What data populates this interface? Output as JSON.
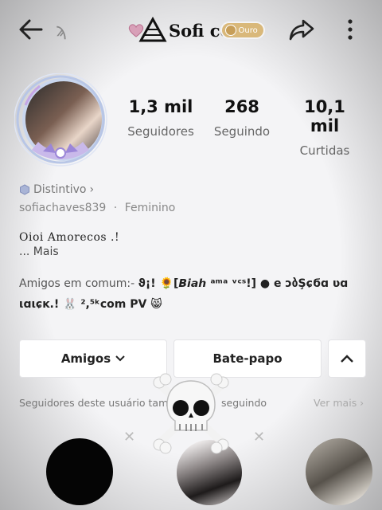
{
  "header": {
    "small_glyph": "ϡ",
    "brand_name": "Sofi col",
    "badge_label": "Ouro"
  },
  "profile": {
    "stats": [
      {
        "value": "1,3 mil",
        "label": "Seguidores"
      },
      {
        "value": "268",
        "label": "Seguindo"
      },
      {
        "value": "10,1 mil",
        "label": "Curtidas"
      }
    ],
    "distintivo_label": "Distintivo",
    "distintivo_arrow": "›",
    "username": "sofiachaves839",
    "separator": "·",
    "gender": "Feminino",
    "bio_line1": "Oioi Amorecos .!",
    "bio_more": "...  Mais",
    "mutual_prefix": "Amigos em comum:- ",
    "mutual_names_1": "ϑ¡! 🌻[𝘽𝙞𝙖𝙝 ᵃᵐᵃ ᵛᶜˢ!] ● e ɔბŞɕϭɑ ʋɑ",
    "mutual_names_2": "ιɑιɕĸ.! 🐰 ²,⁵ᵏcom PV 😸"
  },
  "actions": {
    "amigos_label": "Amigos",
    "chat_label": "Bate-papo",
    "chevron_down": "⌄",
    "chevron_up": "^"
  },
  "suggestions": {
    "header_text": "Seguidores deste usuário tam",
    "header_text_2": "seguindo",
    "see_more": "Ver mais ›",
    "close_glyph": "✕"
  },
  "colors": {
    "background": "#f4f4f6",
    "badge": "#d9b87a",
    "avatar_ring": "#c9d6ee",
    "text_muted": "#666666"
  },
  "icons": [
    "back-arrow-icon",
    "heart-icon",
    "triangle-logo-icon",
    "share-icon",
    "more-vertical-icon",
    "hexagon-icon",
    "chevron-down-icon",
    "chevron-up-icon",
    "close-icon",
    "skull-crossbones-icon"
  ]
}
